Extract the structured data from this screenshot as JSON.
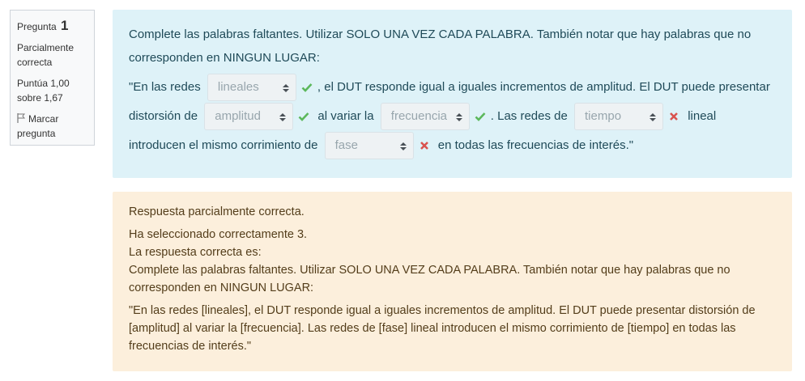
{
  "question_info": {
    "number_prefix": "Pregunta",
    "number": "1",
    "state": "Parcialmente correcta",
    "grade": "Puntúa 1,00 sobre 1,67",
    "flag_label": "Marcar pregunta"
  },
  "formulation": {
    "prompt": "Complete las palabras faltantes. Utilizar SOLO UNA VEZ CADA PALABRA. También notar que hay palabras que no corresponden en NINGUN LUGAR:",
    "seg1": "\"En las redes",
    "sel1": "lineales",
    "seg2": ", el DUT responde igual a iguales incrementos de amplitud. El DUT puede presentar distorsión de",
    "sel2": "amplitud",
    "seg3": "al variar la",
    "sel3": "frecuencia",
    "seg4": ". Las redes de",
    "sel4": "tiempo",
    "seg5": "lineal introducen el mismo corrimiento de",
    "sel5": "fase",
    "seg6": "en todas las frecuencias de interés.\"",
    "marks": [
      "correct",
      "correct",
      "correct",
      "incorrect",
      "incorrect"
    ]
  },
  "feedback": {
    "overall": "Respuesta parcialmente correcta.",
    "num_correct": "Ha seleccionado correctamente 3.",
    "right_answer_intro": "La respuesta correcta es:",
    "right_answer_prompt": "Complete las palabras faltantes. Utilizar SOLO UNA VEZ CADA PALABRA. También notar que hay palabras que no corresponden en NINGUN LUGAR:",
    "right_answer_text": "\"En las redes [lineales], el DUT responde igual a iguales incrementos de amplitud. El DUT puede presentar distorsión de [amplitud] al variar la [frecuencia]. Las redes de [fase] lineal introducen el mismo corrimiento de [tiempo] en todas las frecuencias de interés.\""
  },
  "colors": {
    "correct": "#5cb85c",
    "incorrect": "#d9534f",
    "content_bg": "#def2f8",
    "feedback_bg": "#fcefdc"
  }
}
